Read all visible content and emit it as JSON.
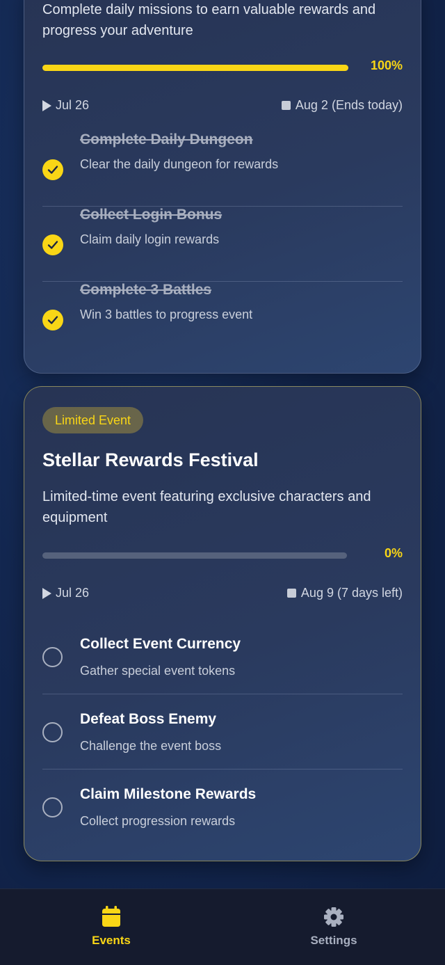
{
  "colors": {
    "accent": "#f9d616",
    "card_bg": "#2a3a5e",
    "nav_bg": "#151b2e",
    "inactive": "#a9b0c0"
  },
  "events": [
    {
      "description": "Complete daily missions to earn valuable rewards and progress your adventure",
      "progress_label": "100%",
      "progress": 1.0,
      "start_date": "Jul 26",
      "end_date": "Aug 2 (Ends today)",
      "tasks": [
        {
          "title": "Complete Daily Dungeon",
          "subtitle": "Clear the daily dungeon for rewards",
          "done": true
        },
        {
          "title": "Collect Login Bonus",
          "subtitle": "Claim daily login rewards",
          "done": true
        },
        {
          "title": "Complete 3 Battles",
          "subtitle": "Win 3 battles to progress event",
          "done": true
        }
      ]
    },
    {
      "badge": "Limited Event",
      "title": "Stellar Rewards Festival",
      "description": "Limited-time event featuring exclusive characters and equipment",
      "progress_label": "0%",
      "progress": 0.0,
      "start_date": "Jul 26",
      "end_date": "Aug 9 (7 days left)",
      "tasks": [
        {
          "title": "Collect Event Currency",
          "subtitle": "Gather special event tokens",
          "done": false
        },
        {
          "title": "Defeat Boss Enemy",
          "subtitle": "Challenge the event boss",
          "done": false
        },
        {
          "title": "Claim Milestone Rewards",
          "subtitle": "Collect progression rewards",
          "done": false
        }
      ]
    }
  ],
  "nav": [
    {
      "label": "Events",
      "icon": "calendar-icon",
      "active": true
    },
    {
      "label": "Settings",
      "icon": "gear-icon",
      "active": false
    }
  ]
}
